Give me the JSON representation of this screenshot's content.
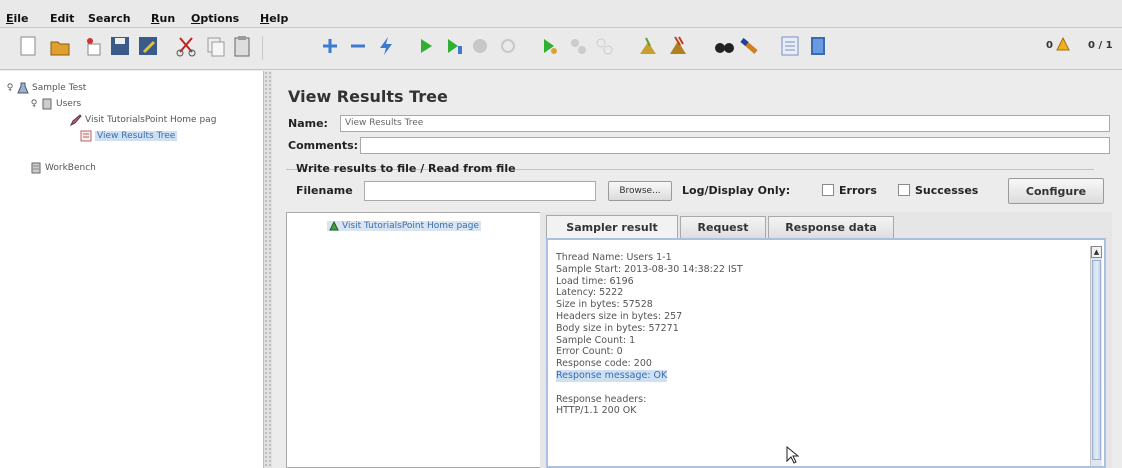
{
  "menu": [
    {
      "label": "Eile",
      "mnemonic": "E"
    },
    {
      "label": "Edit",
      "mnemonic": ""
    },
    {
      "label": "Search",
      "mnemonic": ""
    },
    {
      "label": "Run",
      "mnemonic": "R"
    },
    {
      "label": "Options",
      "mnemonic": "O"
    },
    {
      "label": "Help",
      "mnemonic": "H"
    }
  ],
  "toolbar": {
    "icons": [
      "new-icon",
      "open-icon",
      "open-template-icon",
      "save-icon",
      "save-as-icon",
      "cut-icon",
      "copy-icon",
      "paste-icon",
      "expand-icon",
      "collapse-icon",
      "toggle-icon",
      "start-icon",
      "start-no-pause-icon",
      "stop-icon",
      "shutdown-icon",
      "remote-start-icon",
      "remote-stop-icon",
      "remote-exit-icon",
      "clear-icon",
      "clear-all-icon",
      "search-icon",
      "reset-search-icon",
      "function-helper-icon",
      "help-icon"
    ],
    "warning_count": "0",
    "thread_counter": "0 / 1"
  },
  "tree": {
    "root": "Sample Test",
    "thread_group": "Users",
    "sampler": "Visit TutorialsPoint Home pag",
    "listener": "View Results Tree",
    "workbench": "WorkBench"
  },
  "panel": {
    "title": "View Results Tree",
    "name_label": "Name:",
    "name_value": "View Results Tree",
    "comments_label": "Comments:",
    "comments_value": "",
    "file_group_title": "Write results to file / Read from file",
    "filename_label": "Filename",
    "filename_value": "",
    "browse_label": "Browse...",
    "log_display_label": "Log/Display Only:",
    "errors_label": "Errors",
    "successes_label": "Successes",
    "configure_label": "Configure"
  },
  "results": {
    "item": "Visit TutorialsPoint Home page",
    "tabs": [
      "Sampler result",
      "Request",
      "Response data"
    ],
    "active_tab": "Sampler result",
    "lines": [
      "Thread Name: Users 1-1",
      "Sample Start: 2013-08-30 14:38:22 IST",
      "Load time: 6196",
      "Latency: 5222",
      "Size in bytes: 57528",
      "Headers size in bytes: 257",
      "Body size in bytes: 57271",
      "Sample Count: 1",
      "Error Count: 0",
      "Response code: 200",
      "Response message: OK",
      "",
      "Response headers:",
      "HTTP/1.1 200 OK"
    ]
  },
  "colors": {
    "selection": "#cfe0f2",
    "selection_text": "#3a6fb0",
    "tab_border": "#aac0e0"
  }
}
